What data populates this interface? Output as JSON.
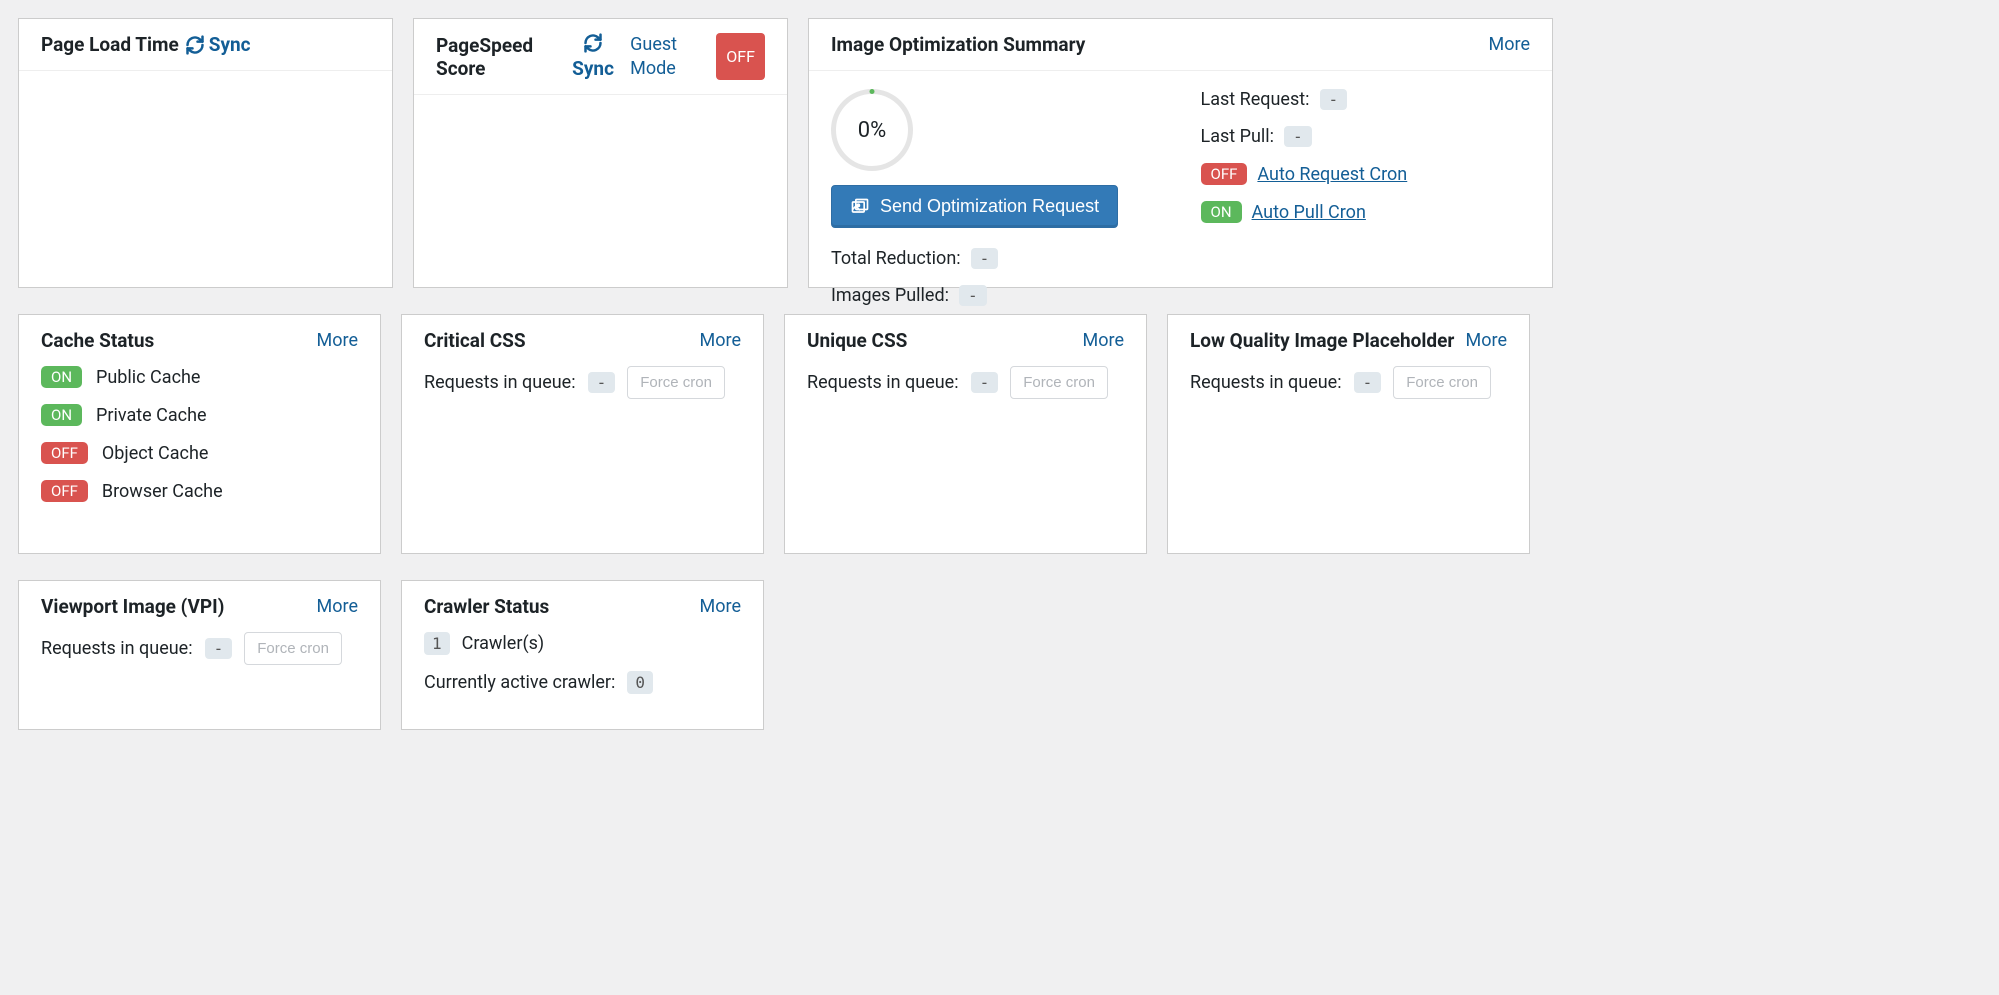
{
  "page_load": {
    "title": "Page Load Time",
    "sync_label": "Sync"
  },
  "pagespeed": {
    "title": "PageSpeed Score",
    "sync_label": "Sync",
    "guest_mode_label": "Guest Mode",
    "guest_status": "OFF"
  },
  "image_opt": {
    "title": "Image Optimization Summary",
    "more": "More",
    "gauge_value": "0%",
    "button_label": "Send Optimization Request",
    "total_reduction_label": "Total Reduction:",
    "total_reduction_value": "-",
    "images_pulled_label": "Images Pulled:",
    "images_pulled_value": "-",
    "last_request_label": "Last Request:",
    "last_request_value": "-",
    "last_pull_label": "Last Pull:",
    "last_pull_value": "-",
    "auto_request_status": "OFF",
    "auto_request_label": "Auto Request Cron",
    "auto_pull_status": "ON",
    "auto_pull_label": "Auto Pull Cron"
  },
  "cache_status": {
    "title": "Cache Status",
    "more": "More",
    "items": [
      {
        "status": "ON",
        "label": "Public Cache"
      },
      {
        "status": "ON",
        "label": "Private Cache"
      },
      {
        "status": "OFF",
        "label": "Object Cache"
      },
      {
        "status": "OFF",
        "label": "Browser Cache"
      }
    ]
  },
  "critical_css": {
    "title": "Critical CSS",
    "more": "More",
    "queue_label": "Requests in queue:",
    "queue_value": "-",
    "force_label": "Force cron"
  },
  "unique_css": {
    "title": "Unique CSS",
    "more": "More",
    "queue_label": "Requests in queue:",
    "queue_value": "-",
    "force_label": "Force cron"
  },
  "lqip": {
    "title": "Low Quality Image Placeholder",
    "more": "More",
    "queue_label": "Requests in queue:",
    "queue_value": "-",
    "force_label": "Force cron"
  },
  "vpi": {
    "title": "Viewport Image (VPI)",
    "more": "More",
    "queue_label": "Requests in queue:",
    "queue_value": "-",
    "force_label": "Force cron"
  },
  "crawler": {
    "title": "Crawler Status",
    "more": "More",
    "count_value": "1",
    "count_label": "Crawler(s)",
    "active_label": "Currently active crawler:",
    "active_value": "0"
  }
}
